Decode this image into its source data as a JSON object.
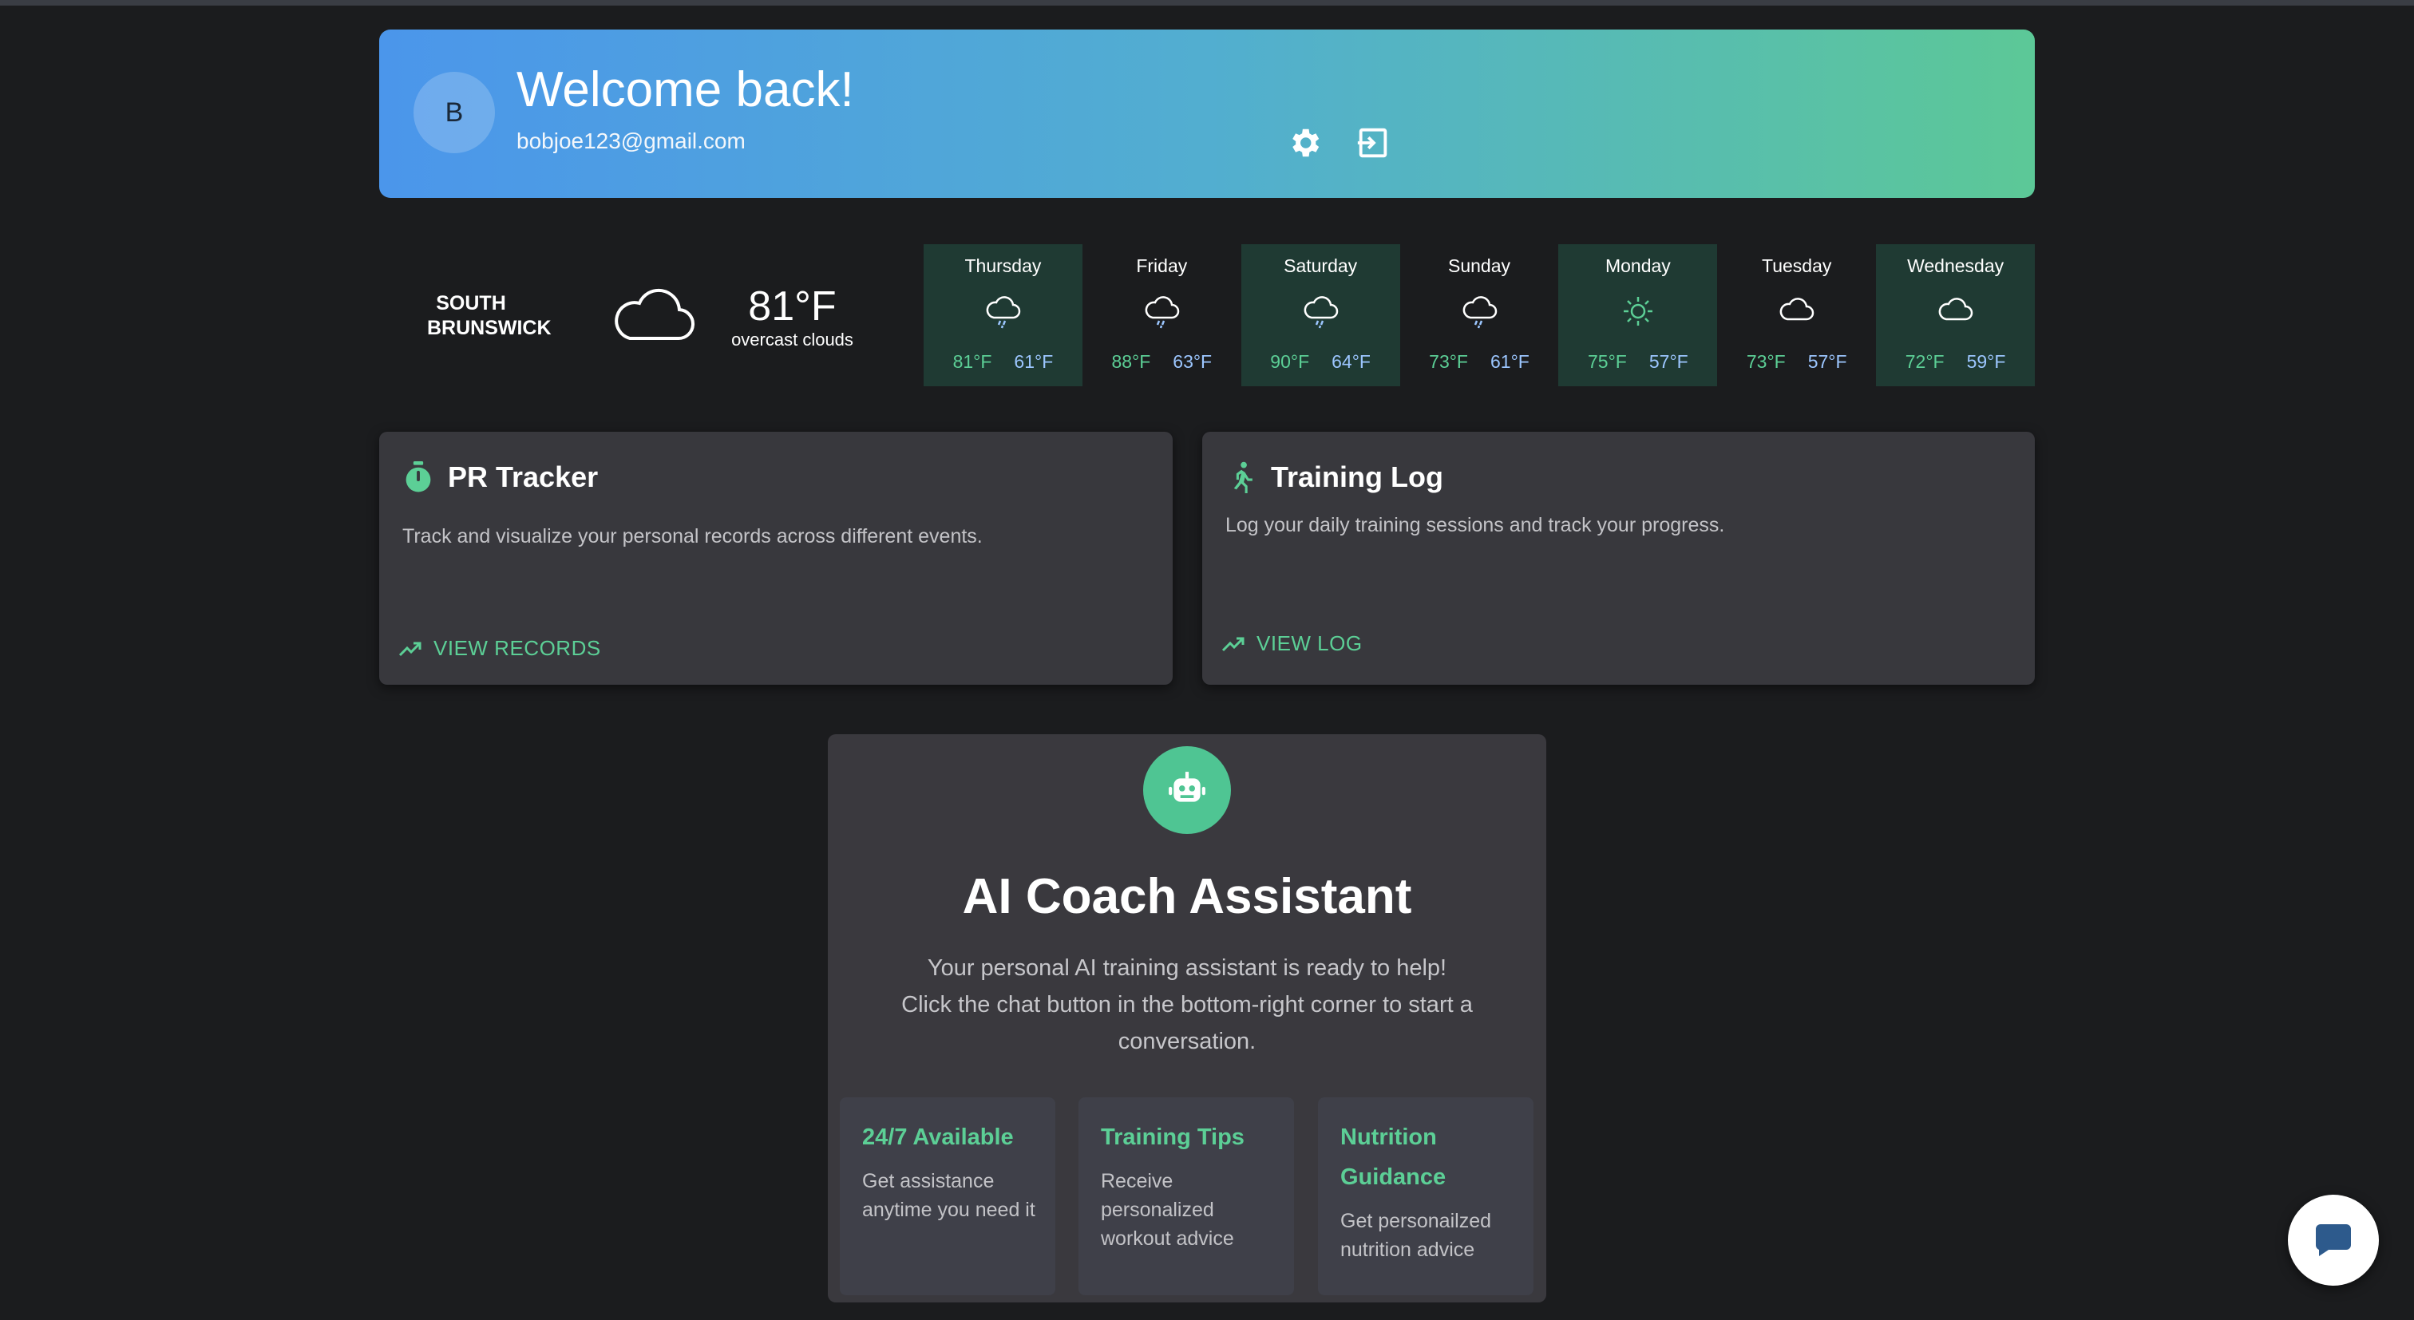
{
  "header": {
    "avatar_initial": "B",
    "welcome": "Welcome back!",
    "email": "bobjoe123@gmail.com",
    "settings_icon": "gear-icon",
    "logout_icon": "logout-icon"
  },
  "weather": {
    "city": "SOUTH BRUNSWICK",
    "current_icon": "cloud-icon",
    "current_temp": "81°F",
    "current_desc": "overcast clouds",
    "forecast": [
      {
        "day": "Thursday",
        "icon": "rain-cloud-icon",
        "high": "81°F",
        "low": "61°F"
      },
      {
        "day": "Friday",
        "icon": "rain-cloud-icon",
        "high": "88°F",
        "low": "63°F"
      },
      {
        "day": "Saturday",
        "icon": "rain-cloud-icon",
        "high": "90°F",
        "low": "64°F"
      },
      {
        "day": "Sunday",
        "icon": "rain-cloud-icon",
        "high": "73°F",
        "low": "61°F"
      },
      {
        "day": "Monday",
        "icon": "sun-icon",
        "high": "75°F",
        "low": "57°F"
      },
      {
        "day": "Tuesday",
        "icon": "cloud-icon",
        "high": "73°F",
        "low": "57°F"
      },
      {
        "day": "Wednesday",
        "icon": "cloud-icon",
        "high": "72°F",
        "low": "59°F"
      }
    ]
  },
  "pr_tracker": {
    "icon": "stopwatch-icon",
    "title": "PR Tracker",
    "description": "Track and visualize your personal records across different events.",
    "link": "VIEW RECORDS"
  },
  "training_log": {
    "icon": "running-icon",
    "title": "Training Log",
    "description": "Log your daily training sessions and track your progress.",
    "link": "VIEW LOG"
  },
  "coach": {
    "icon": "robot-icon",
    "title": "AI Coach Assistant",
    "description": "Your personal AI training assistant is ready to help! Click the chat button in the bottom-right corner to start a conversation.",
    "features": [
      {
        "title": "24/7 Available",
        "desc": "Get assistance anytime you need it"
      },
      {
        "title": "Training Tips",
        "desc": "Receive personalized workout advice"
      },
      {
        "title": "Nutrition Guidance",
        "desc": "Get personailzed nutrition advice"
      }
    ]
  },
  "chat_button_icon": "chat-icon",
  "colors": {
    "accent": "#5ccf96",
    "background": "#1b1c1e",
    "card": "#38383d",
    "header_start": "#4b96eb",
    "header_end": "#5cc897"
  }
}
